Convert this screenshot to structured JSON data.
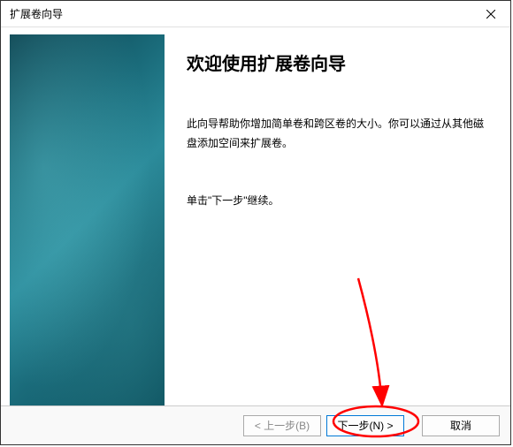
{
  "titlebar": {
    "title": "扩展卷向导"
  },
  "main": {
    "heading": "欢迎使用扩展卷向导",
    "body": "此向导帮助你增加简单卷和跨区卷的大小。你可以通过从其他磁盘添加空间来扩展卷。",
    "instruction": "单击\"下一步\"继续。"
  },
  "buttons": {
    "back": "< 上一步(B)",
    "next": "下一步(N) >",
    "cancel": "取消"
  }
}
